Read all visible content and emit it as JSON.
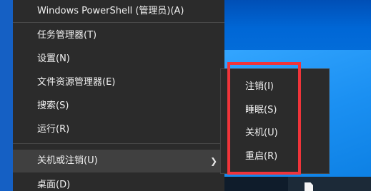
{
  "menu": {
    "items": [
      {
        "label": "Windows PowerShell (管理员)(A)"
      },
      {
        "label": "任务管理器(T)"
      },
      {
        "label": "设置(N)"
      },
      {
        "label": "文件资源管理器(E)"
      },
      {
        "label": "搜索(S)"
      },
      {
        "label": "运行(R)"
      },
      {
        "label": "关机或注销(U)",
        "has_submenu": true
      },
      {
        "label": "桌面(D)"
      }
    ]
  },
  "submenu": {
    "items": [
      {
        "label": "注销(I)"
      },
      {
        "label": "睡眠(S)"
      },
      {
        "label": "关机(U)"
      },
      {
        "label": "重启(R)"
      }
    ]
  },
  "icons": {
    "submenu_arrow": "chevron-right-icon",
    "taskbar_item": "document-icon"
  },
  "colors": {
    "menu_background": "#2b2b2b",
    "menu_highlight": "#404040",
    "annotation": "#f0343a",
    "desktop": "#0a78e0"
  }
}
